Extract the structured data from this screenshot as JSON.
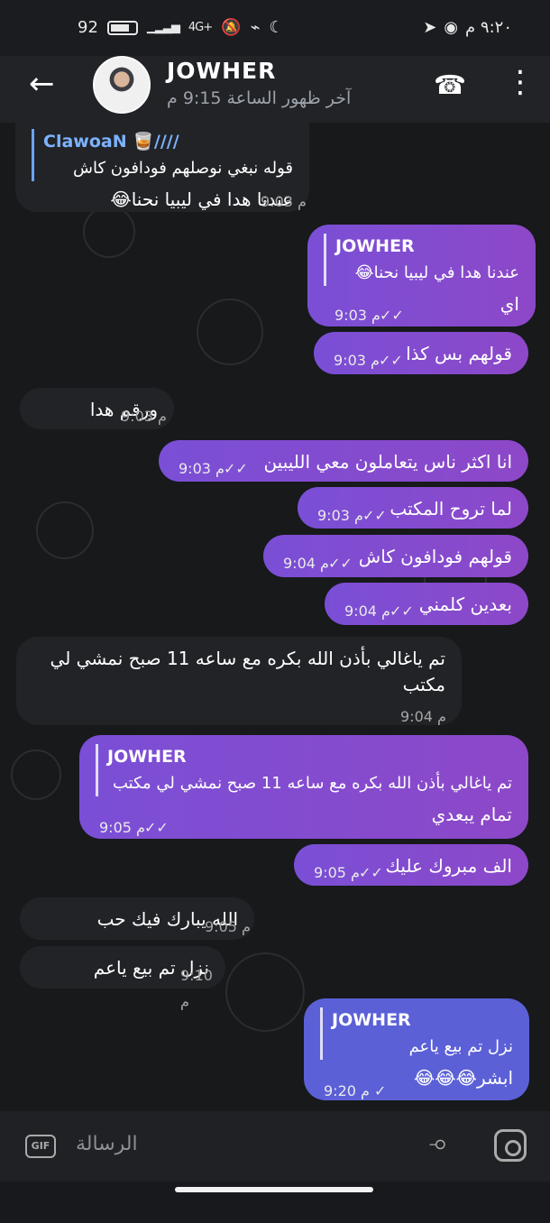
{
  "statusbar": {
    "battery": "92",
    "network": "4G+",
    "time": "٩:٢٠ م"
  },
  "header": {
    "name": "JOWHER",
    "last_seen": "آخر ظهور الساعة 9:15 م"
  },
  "messages": [
    {
      "direction": "in",
      "reply_name": "ClawoaN 🥃////",
      "reply_text": "قوله نبغي نوصلهم فودافون كاش",
      "text": "عندنا هدا في ليبيا نحنا😂",
      "time": "9:03 م"
    },
    {
      "direction": "out",
      "reply_name": "JOWHER",
      "reply_text": "عندنا هدا في ليبيا نحنا😂",
      "text": "اي",
      "time": "9:03 م"
    },
    {
      "direction": "out",
      "text": "قولهم بس كذا",
      "time": "9:03 م"
    },
    {
      "direction": "in",
      "text": "ورقم هدا",
      "time": "9:03 م"
    },
    {
      "direction": "out",
      "text": "انا اكثر ناس يتعاملون معي الليبين",
      "time": "9:03 م"
    },
    {
      "direction": "out",
      "text": "لما تروح المكتب",
      "time": "9:03 م"
    },
    {
      "direction": "out",
      "text": "قولهم فودافون كاش",
      "time": "9:04 م"
    },
    {
      "direction": "out",
      "text": "بعدين كلمني",
      "time": "9:04 م"
    },
    {
      "direction": "in",
      "text": "تم ياغالي بأذن الله بكره مع ساعه 11 صبح نمشي لي مكتب",
      "time": "9:04 م"
    },
    {
      "direction": "out",
      "reply_name": "JOWHER",
      "reply_text": "تم ياغالي بأذن الله بكره مع ساعه 11 صبح نمشي لي مكتب",
      "text": "تمام يبعدي",
      "time": "9:05 م"
    },
    {
      "direction": "out",
      "text": "الف مبروك عليك",
      "time": "9:05 م"
    },
    {
      "direction": "in",
      "text": "الله يبارك فيك حب",
      "time": "9:05 م"
    },
    {
      "direction": "in",
      "text": "نزل تم بيع ياعم",
      "time": "9:10 م"
    },
    {
      "direction": "out",
      "reply_name": "JOWHER",
      "reply_text": "نزل تم بيع ياعم",
      "text": "ابشر😂😂😂",
      "time": "9:20 م"
    }
  ],
  "input": {
    "gif_label": "GIF",
    "placeholder": "الرسالة"
  },
  "icons": {
    "back": "back-arrow-icon",
    "call": "phone-icon",
    "menu": "more-vertical-icon",
    "attach": "paperclip-icon",
    "camera": "camera-icon"
  },
  "colors": {
    "outgoing": "#8b4cd0",
    "incoming": "#212327",
    "last_outgoing": "#5b60d7",
    "background": "#17191c"
  }
}
